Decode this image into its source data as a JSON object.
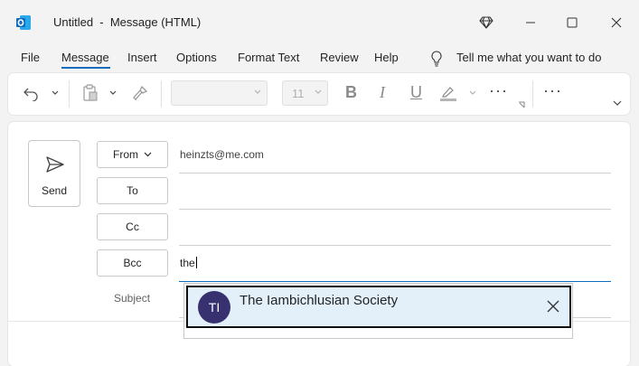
{
  "window": {
    "title": "Untitled  -  Message (HTML)"
  },
  "menu": {
    "items": [
      {
        "label": "File"
      },
      {
        "label": "Message",
        "active": true
      },
      {
        "label": "Insert"
      },
      {
        "label": "Options"
      },
      {
        "label": "Format Text"
      },
      {
        "label": "Review"
      },
      {
        "label": "Help"
      }
    ],
    "tell_me": "Tell me what you want to do"
  },
  "ribbon": {
    "font_name": "",
    "font_size": "11",
    "bold": "B",
    "italic": "I",
    "underline": "U",
    "more": "···",
    "overflow": "···"
  },
  "compose": {
    "send_label": "Send",
    "from_label": "From",
    "from_value": "heinzts@me.com",
    "to_label": "To",
    "to_value": "",
    "cc_label": "Cc",
    "cc_value": "",
    "bcc_label": "Bcc",
    "bcc_value": "the",
    "subject_label": "Subject"
  },
  "autocomplete": {
    "initials": "TI",
    "name": "The Iambichlusian Society"
  },
  "colors": {
    "accent": "#0f6cbd",
    "avatar": "#37316f",
    "suggestion_bg": "#e3eff9"
  }
}
